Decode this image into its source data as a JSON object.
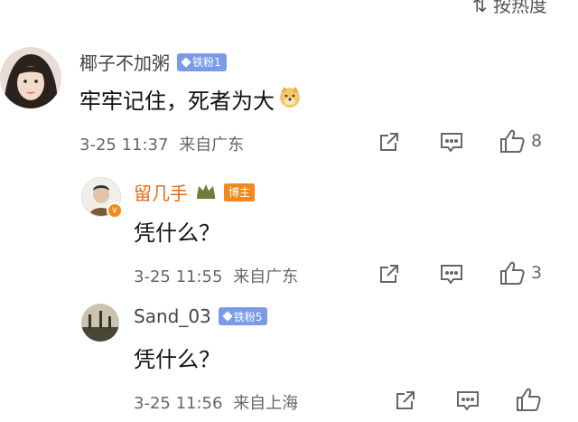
{
  "sort_label": "按热度",
  "comments": [
    {
      "name": "椰子不加粥",
      "badge": "铁粉1",
      "text": "牢牢记住，死者为大",
      "timestamp": "3-25 11:37",
      "location": "来自广东",
      "like_count": "8",
      "icons": [
        "share-icon",
        "comment-icon",
        "like-icon"
      ]
    },
    {
      "name": "留几手",
      "badge": "博主",
      "is_author": true,
      "text": "凭什么？",
      "timestamp": "3-25 11:55",
      "location": "来自广东",
      "like_count": "3",
      "icons": [
        "share-icon",
        "comment-icon",
        "like-icon"
      ]
    },
    {
      "name": "Sand_03",
      "badge": "铁粉5",
      "text": "凭什么？",
      "timestamp": "3-25 11:56",
      "location": "来自上海",
      "like_count": "",
      "icons": [
        "share-icon",
        "comment-icon",
        "like-icon"
      ]
    }
  ],
  "colors": {
    "author_name": "#e86b12",
    "fan_badge": "#7b9be8",
    "blogger_badge": "#f08a1c",
    "meta_text": "#666666"
  }
}
